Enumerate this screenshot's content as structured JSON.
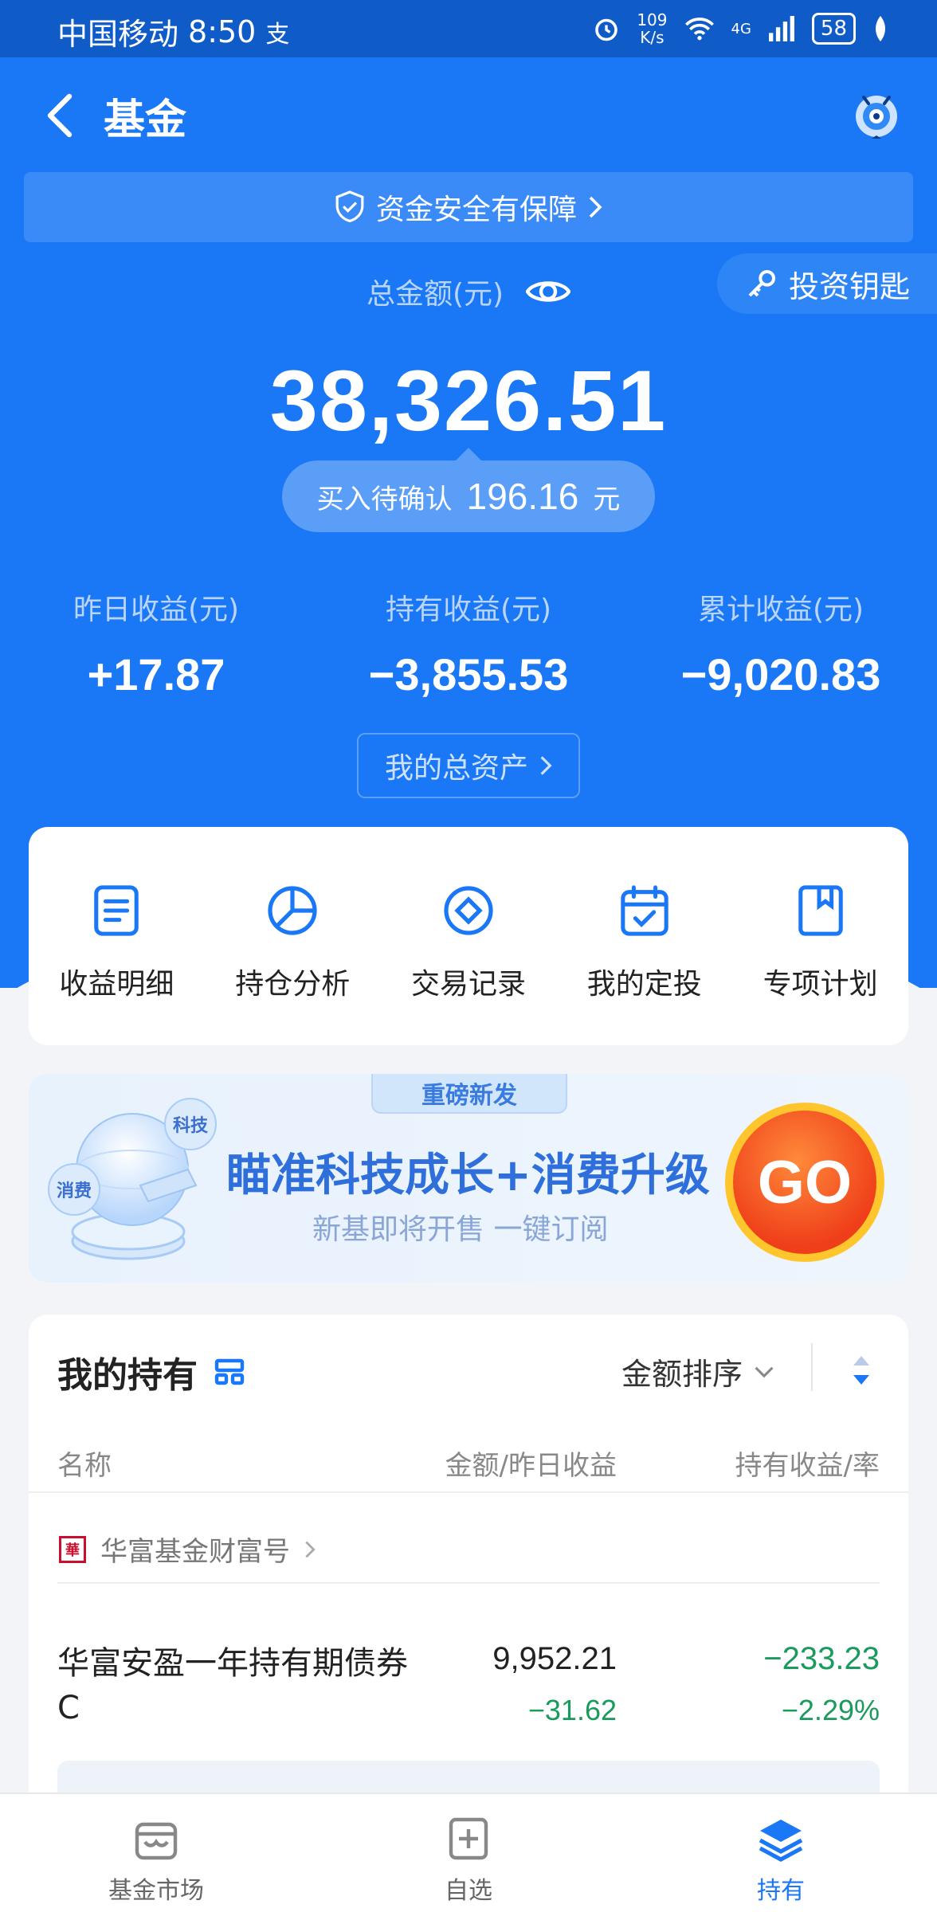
{
  "status_bar": {
    "carrier": "中国移动",
    "time": "8:50",
    "net_speed_value": "109",
    "net_speed_unit": "K/s",
    "network": "4G",
    "battery": "58"
  },
  "nav": {
    "title": "基金"
  },
  "safety_banner": {
    "text": "资金安全有保障"
  },
  "invest_key": {
    "label": "投资钥匙"
  },
  "summary": {
    "total_label": "总金额(元)",
    "total_amount": "38,326.51",
    "pending_label": "买入待确认",
    "pending_amount": "196.16",
    "pending_unit": "元",
    "stats": [
      {
        "label": "昨日收益(元)",
        "value": "+17.87"
      },
      {
        "label": "持有收益(元)",
        "value": "−3,855.53"
      },
      {
        "label": "累计收益(元)",
        "value": "−9,020.83"
      }
    ],
    "assets_button": "我的总资产"
  },
  "actions": [
    {
      "label": "收益明细",
      "icon": "document-icon"
    },
    {
      "label": "持仓分析",
      "icon": "pie-chart-icon"
    },
    {
      "label": "交易记录",
      "icon": "diamond-icon"
    },
    {
      "label": "我的定投",
      "icon": "calendar-check-icon"
    },
    {
      "label": "专项计划",
      "icon": "bookmark-icon"
    }
  ],
  "promo": {
    "tag": "重磅新发",
    "title": "瞄准科技成长+消费升级",
    "subtitle": "新基即将开售 一键订阅",
    "go_label": "GO",
    "bubble_tech": "科技",
    "bubble_consume": "消费"
  },
  "holdings": {
    "title": "我的持有",
    "sort_label": "金额排序",
    "col_name": "名称",
    "col_amount": "金额/昨日收益",
    "col_hold": "持有收益/率",
    "company": "华富基金财富号",
    "fund": {
      "name": "华富安盈一年持有期债券C",
      "amount": "9,952.21",
      "yesterday": "−31.62",
      "hold_profit": "−233.23",
      "hold_rate": "−2.29%"
    }
  },
  "tabbar": {
    "tabs": [
      {
        "label": "基金市场"
      },
      {
        "label": "自选"
      },
      {
        "label": "持有"
      }
    ]
  },
  "colors": {
    "brand_blue": "#1a77f5",
    "loss_green": "#1a9a5c",
    "promo_orange": "#ef3f1a"
  }
}
